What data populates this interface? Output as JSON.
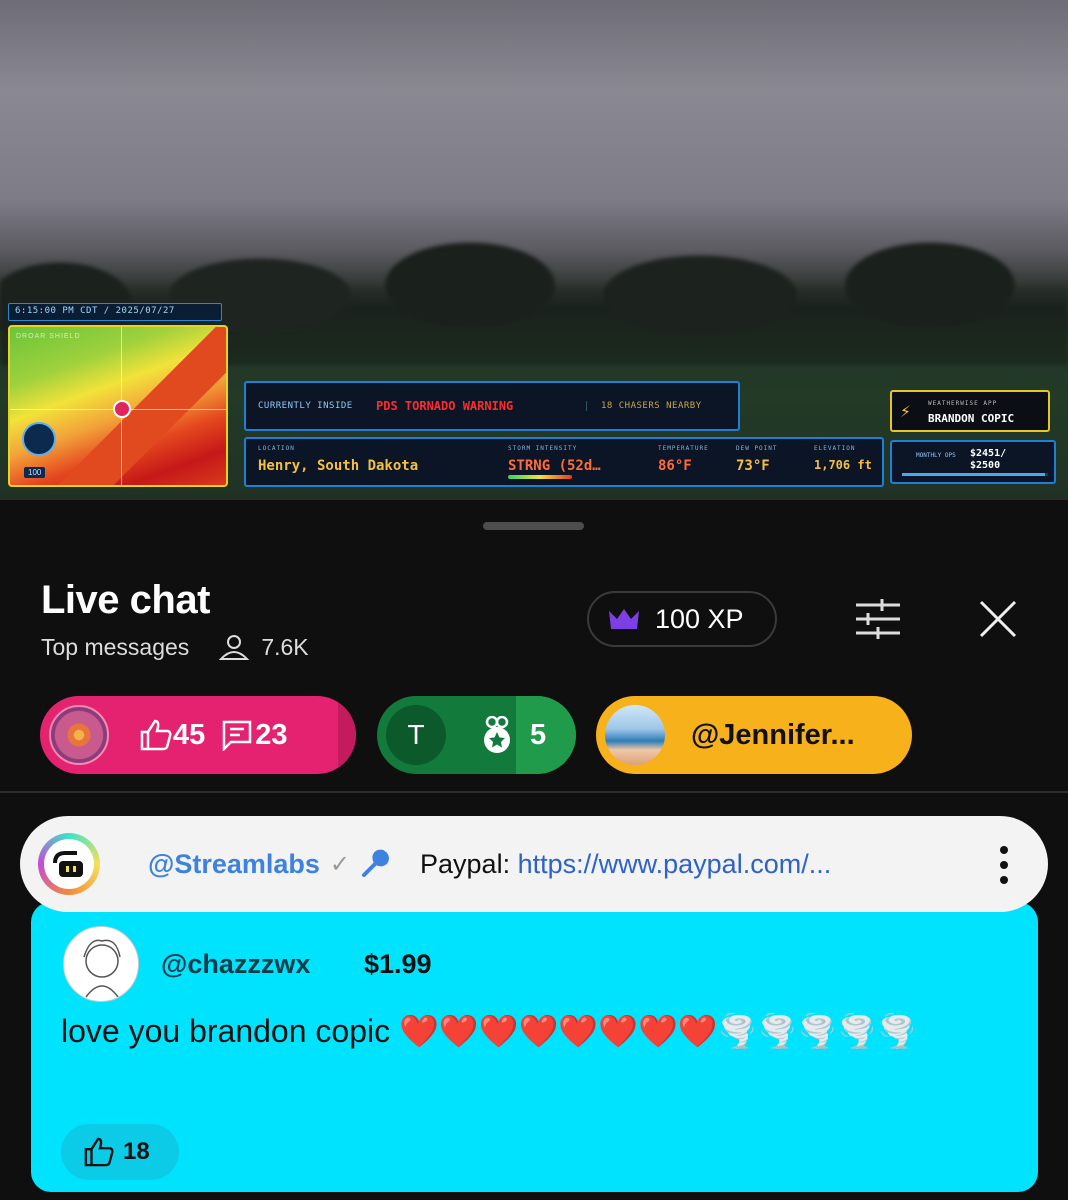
{
  "video": {
    "hud": {
      "time": "6:15:00 PM CDT / 2025/07/27",
      "map_label": "DROAR SHIELD",
      "map_scale": "100",
      "currently_inside_label": "CURRENTLY INSIDE",
      "warning": "PDS TORNADO WARNING",
      "chasers": "18 CHASERS NEARBY",
      "location_label": "LOCATION",
      "location": "Henry, South Dakota",
      "intensity_label": "STORM INTENSITY",
      "intensity": "STRNG (52d…",
      "temperature_label": "TEMPERATURE",
      "temperature": "86°F",
      "dew_point_label": "DEW POINT",
      "dew_point": "73°F",
      "elevation_label": "ELEVATION",
      "elevation": "1,706 ft",
      "app_label": "WEATHERWISE APP",
      "streamer": "BRANDON COPIC",
      "goal_label": "MONTHLY OPS",
      "goal_current": "$2451/",
      "goal_target": "$2500",
      "goal_fraction": 0.98
    }
  },
  "chat": {
    "title": "Live chat",
    "mode": "Top messages",
    "viewers": "7.6K",
    "xp": "100 XP",
    "chips": [
      {
        "likes": "45",
        "comments": "23"
      },
      {
        "initial": "T",
        "gifts": "5"
      },
      {
        "user": "@Jennifer..."
      }
    ],
    "pinned": {
      "author": "@Streamlabs",
      "label": "Paypal: ",
      "link": "https://www.paypal.com/..."
    },
    "superchat": {
      "user": "@chazzzwx",
      "amount": "$1.99",
      "text": "love you brandon copic ❤️❤️❤️❤️❤️❤️❤️❤️🌪️🌪️🌪️🌪️🌪️",
      "likes": "18"
    }
  },
  "colors": {
    "chip_pink": "#e5226f",
    "chip_green": "#127a3b",
    "chip_yellow": "#f7b11b",
    "superchat_bg": "#00e3ff",
    "link": "#2d62c8"
  }
}
